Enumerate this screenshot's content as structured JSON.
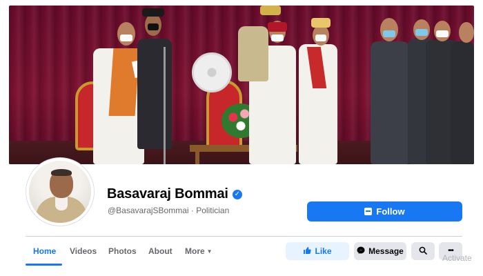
{
  "profile": {
    "name": "Basavaraj Bommai",
    "verified_mark": "✓",
    "subtitle": "@BasavarajSBommai · Politician"
  },
  "actions": {
    "follow_label": "Follow",
    "like_label": "Like",
    "message_label": "Message",
    "search_icon": "⌕",
    "more_icon": "•••"
  },
  "tabs": [
    {
      "label": "Home",
      "active": true
    },
    {
      "label": "Videos",
      "active": false
    },
    {
      "label": "Photos",
      "active": false
    },
    {
      "label": "About",
      "active": false
    },
    {
      "label": "More",
      "active": false
    }
  ],
  "more_caret": "▼",
  "watermark": "Activate",
  "colors": {
    "accent": "#1877f2",
    "button_gray": "#e4e6eb",
    "like_bg": "#e7f3ff",
    "curtain": "#7d1232"
  },
  "icons": {
    "follow": "follow-icon",
    "like": "thumbs-up-icon",
    "message": "messenger-icon",
    "search": "search-icon",
    "more": "more-dots-icon"
  }
}
